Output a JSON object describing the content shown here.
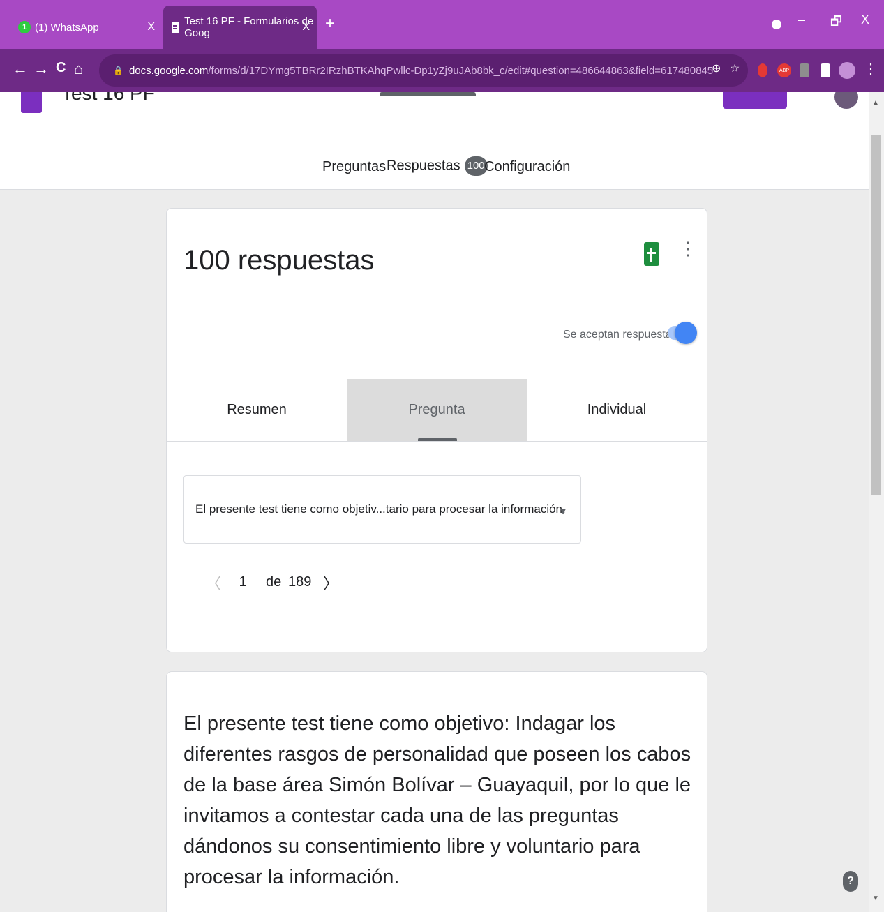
{
  "browser": {
    "tabs": [
      {
        "title": "(1) WhatsApp",
        "badge": "1",
        "close": "X"
      },
      {
        "title": "Test 16 PF - Formularios de Goog",
        "close": "X"
      }
    ],
    "new_tab": "+",
    "window_controls": {
      "minimize": "–",
      "restore": "🗗",
      "close": "X"
    },
    "nav": {
      "back": "←",
      "forward": "→",
      "reload": "C",
      "home": "⌂"
    },
    "url": {
      "lock": "🔒",
      "host": "docs.google.com",
      "path": "/forms/d/17DYmg5TBRr2IRzhBTKAhqPwllc-Dp1yZj9uJAb8bk_c/edit#question=486644863&field=617480845"
    },
    "omnibox_icons": {
      "zoom": "⊕",
      "star": "☆"
    },
    "extensions": {
      "abp": "ABP",
      "more": "⋮"
    }
  },
  "form": {
    "title": "Test 16 PF"
  },
  "nav_tabs": {
    "questions": "Preguntas",
    "responses": "Respuestas",
    "responses_count": "100",
    "settings": "Configuración"
  },
  "summary_card": {
    "title": "100 respuestas",
    "more": "⋮",
    "accepting_label": "Se aceptan respuestas",
    "accepting": true,
    "subtabs": {
      "summary": "Resumen",
      "question": "Pregunta",
      "individual": "Individual"
    },
    "active_subtab": "question",
    "question_select": {
      "value": "El presente test tiene como objetiv...tario para procesar la información.",
      "arrow": "▼"
    },
    "pager": {
      "prev": "〈",
      "current": "1",
      "of": "de",
      "total": "189",
      "next": "〉"
    }
  },
  "question_card": {
    "text": "El presente test tiene como objetivo: Indagar los diferentes rasgos de personalidad que poseen los cabos de la base área Simón Bolívar – Guayaquil, por lo que le invitamos a contestar cada una de las preguntas dándonos su consentimiento libre y voluntario para procesar la información."
  },
  "scrollbar": {
    "up": "▲",
    "down": "▼"
  },
  "help": "?"
}
